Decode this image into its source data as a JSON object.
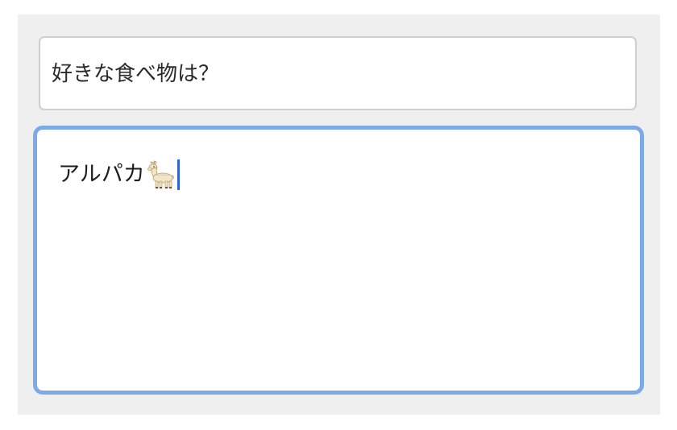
{
  "question": {
    "text": "好きな食べ物は？"
  },
  "answer": {
    "text": "アルパカ",
    "emoji_icon": "llama-icon"
  },
  "colors": {
    "panel_background": "#efefef",
    "focus_ring": "#7aabe6",
    "caret": "#2f63d6",
    "field_border": "#cfcfcf"
  }
}
